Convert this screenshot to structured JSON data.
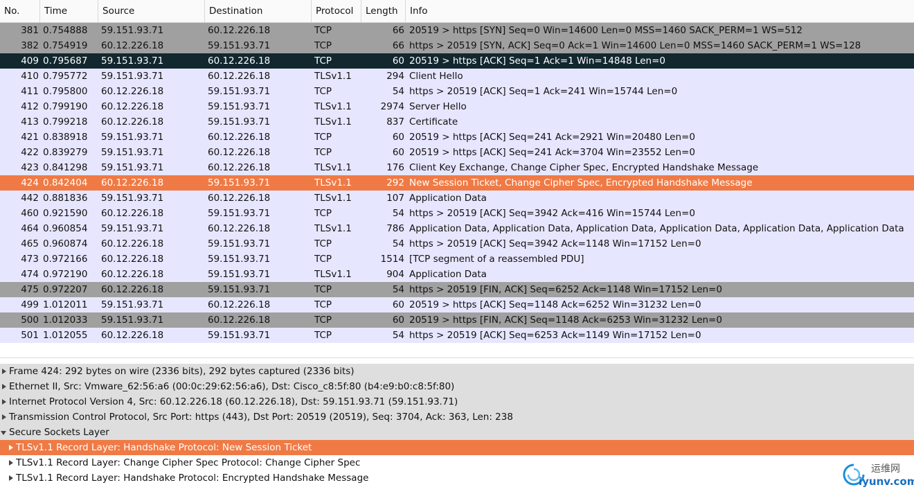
{
  "packet_list": {
    "columns": [
      "No.",
      "Time",
      "Source",
      "Destination",
      "Protocol",
      "Length",
      "Info"
    ],
    "rows": [
      {
        "no": "381",
        "time": "0.754888",
        "src": "59.151.93.71",
        "dst": "60.12.226.18",
        "proto": "TCP",
        "len": "66",
        "info": "20519 > https [SYN] Seq=0 Win=14600 Len=0 MSS=1460 SACK_PERM=1 WS=512",
        "style": "gray"
      },
      {
        "no": "382",
        "time": "0.754919",
        "src": "60.12.226.18",
        "dst": "59.151.93.71",
        "proto": "TCP",
        "len": "66",
        "info": "https > 20519 [SYN, ACK] Seq=0 Ack=1 Win=14600 Len=0 MSS=1460 SACK_PERM=1 WS=128",
        "style": "gray"
      },
      {
        "no": "409",
        "time": "0.795687",
        "src": "59.151.93.71",
        "dst": "60.12.226.18",
        "proto": "TCP",
        "len": "60",
        "info": "20519 > https [ACK] Seq=1 Ack=1 Win=14848 Len=0",
        "style": "dark"
      },
      {
        "no": "410",
        "time": "0.795772",
        "src": "59.151.93.71",
        "dst": "60.12.226.18",
        "proto": "TLSv1.1",
        "len": "294",
        "info": "Client Hello",
        "style": "tcp"
      },
      {
        "no": "411",
        "time": "0.795800",
        "src": "60.12.226.18",
        "dst": "59.151.93.71",
        "proto": "TCP",
        "len": "54",
        "info": "https > 20519 [ACK] Seq=1 Ack=241 Win=15744 Len=0",
        "style": "tcp"
      },
      {
        "no": "412",
        "time": "0.799190",
        "src": "60.12.226.18",
        "dst": "59.151.93.71",
        "proto": "TLSv1.1",
        "len": "2974",
        "info": "Server Hello",
        "style": "tcp"
      },
      {
        "no": "413",
        "time": "0.799218",
        "src": "60.12.226.18",
        "dst": "59.151.93.71",
        "proto": "TLSv1.1",
        "len": "837",
        "info": "Certificate",
        "style": "tcp"
      },
      {
        "no": "421",
        "time": "0.838918",
        "src": "59.151.93.71",
        "dst": "60.12.226.18",
        "proto": "TCP",
        "len": "60",
        "info": "20519 > https [ACK] Seq=241 Ack=2921 Win=20480 Len=0",
        "style": "tcp"
      },
      {
        "no": "422",
        "time": "0.839279",
        "src": "59.151.93.71",
        "dst": "60.12.226.18",
        "proto": "TCP",
        "len": "60",
        "info": "20519 > https [ACK] Seq=241 Ack=3704 Win=23552 Len=0",
        "style": "tcp"
      },
      {
        "no": "423",
        "time": "0.841298",
        "src": "59.151.93.71",
        "dst": "60.12.226.18",
        "proto": "TLSv1.1",
        "len": "176",
        "info": "Client Key Exchange, Change Cipher Spec, Encrypted Handshake Message",
        "style": "tcp"
      },
      {
        "no": "424",
        "time": "0.842404",
        "src": "60.12.226.18",
        "dst": "59.151.93.71",
        "proto": "TLSv1.1",
        "len": "292",
        "info": "New Session Ticket, Change Cipher Spec, Encrypted Handshake Message",
        "style": "sel"
      },
      {
        "no": "442",
        "time": "0.881836",
        "src": "59.151.93.71",
        "dst": "60.12.226.18",
        "proto": "TLSv1.1",
        "len": "107",
        "info": "Application Data",
        "style": "tcp"
      },
      {
        "no": "460",
        "time": "0.921590",
        "src": "60.12.226.18",
        "dst": "59.151.93.71",
        "proto": "TCP",
        "len": "54",
        "info": "https > 20519 [ACK] Seq=3942 Ack=416 Win=15744 Len=0",
        "style": "tcp"
      },
      {
        "no": "464",
        "time": "0.960854",
        "src": "59.151.93.71",
        "dst": "60.12.226.18",
        "proto": "TLSv1.1",
        "len": "786",
        "info": "Application Data, Application Data, Application Data, Application Data, Application Data, Application Data",
        "style": "tcp"
      },
      {
        "no": "465",
        "time": "0.960874",
        "src": "60.12.226.18",
        "dst": "59.151.93.71",
        "proto": "TCP",
        "len": "54",
        "info": "https > 20519 [ACK] Seq=3942 Ack=1148 Win=17152 Len=0",
        "style": "tcp"
      },
      {
        "no": "473",
        "time": "0.972166",
        "src": "60.12.226.18",
        "dst": "59.151.93.71",
        "proto": "TCP",
        "len": "1514",
        "info": "[TCP segment of a reassembled PDU]",
        "style": "tcp"
      },
      {
        "no": "474",
        "time": "0.972190",
        "src": "60.12.226.18",
        "dst": "59.151.93.71",
        "proto": "TLSv1.1",
        "len": "904",
        "info": "Application Data",
        "style": "tcp"
      },
      {
        "no": "475",
        "time": "0.972207",
        "src": "60.12.226.18",
        "dst": "59.151.93.71",
        "proto": "TCP",
        "len": "54",
        "info": "https > 20519 [FIN, ACK] Seq=6252 Ack=1148 Win=17152 Len=0",
        "style": "gray"
      },
      {
        "no": "499",
        "time": "1.012011",
        "src": "59.151.93.71",
        "dst": "60.12.226.18",
        "proto": "TCP",
        "len": "60",
        "info": "20519 > https [ACK] Seq=1148 Ack=6252 Win=31232 Len=0",
        "style": "tcp"
      },
      {
        "no": "500",
        "time": "1.012033",
        "src": "59.151.93.71",
        "dst": "60.12.226.18",
        "proto": "TCP",
        "len": "60",
        "info": "20519 > https [FIN, ACK] Seq=1148 Ack=6253 Win=31232 Len=0",
        "style": "gray"
      },
      {
        "no": "501",
        "time": "1.012055",
        "src": "60.12.226.18",
        "dst": "59.151.93.71",
        "proto": "TCP",
        "len": "54",
        "info": "https > 20519 [ACK] Seq=6253 Ack=1149 Win=17152 Len=0",
        "style": "tcp"
      }
    ]
  },
  "details": [
    {
      "text": "Frame 424: 292 bytes on wire (2336 bits), 292 bytes captured (2336 bits)",
      "expanded": false,
      "level": 0,
      "style": "gray"
    },
    {
      "text": "Ethernet II, Src: Vmware_62:56:a6 (00:0c:29:62:56:a6), Dst: Cisco_c8:5f:80 (b4:e9:b0:c8:5f:80)",
      "expanded": false,
      "level": 0,
      "style": "gray"
    },
    {
      "text": "Internet Protocol Version 4, Src: 60.12.226.18 (60.12.226.18), Dst: 59.151.93.71 (59.151.93.71)",
      "expanded": false,
      "level": 0,
      "style": "gray"
    },
    {
      "text": "Transmission Control Protocol, Src Port: https (443), Dst Port: 20519 (20519), Seq: 3704, Ack: 363, Len: 238",
      "expanded": false,
      "level": 0,
      "style": "gray"
    },
    {
      "text": "Secure Sockets Layer",
      "expanded": true,
      "level": 0,
      "style": "gray"
    },
    {
      "text": "TLSv1.1 Record Layer: Handshake Protocol: New Session Ticket",
      "expanded": false,
      "level": 1,
      "style": "sel"
    },
    {
      "text": "TLSv1.1 Record Layer: Change Cipher Spec Protocol: Change Cipher Spec",
      "expanded": false,
      "level": 1,
      "style": "white"
    },
    {
      "text": "TLSv1.1 Record Layer: Handshake Protocol: Encrypted Handshake Message",
      "expanded": false,
      "level": 1,
      "style": "white"
    }
  ],
  "watermark": {
    "cn": "运维网",
    "url": "iyunv.com",
    "icon": "swirl-logo-icon"
  },
  "colors": {
    "tcp": "#e7e6ff",
    "gray": "#a0a0a0",
    "dark": "#12272e",
    "selected": "#f07a45"
  }
}
